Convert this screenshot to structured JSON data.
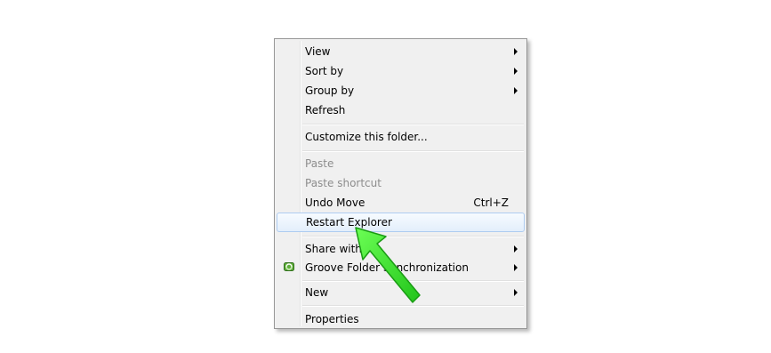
{
  "menu": {
    "items": [
      {
        "label": "View",
        "has_submenu": true
      },
      {
        "label": "Sort by",
        "has_submenu": true
      },
      {
        "label": "Group by",
        "has_submenu": true
      },
      {
        "label": "Refresh"
      },
      {
        "label": "Customize this folder..."
      },
      {
        "label": "Paste",
        "disabled": true
      },
      {
        "label": "Paste shortcut",
        "disabled": true
      },
      {
        "label": "Undo Move",
        "shortcut": "Ctrl+Z"
      },
      {
        "label": "Restart Explorer",
        "highlighted": true
      },
      {
        "label": "Share with",
        "has_submenu": true
      },
      {
        "label": "Groove Folder Synchronization",
        "has_submenu": true,
        "icon": "groove-icon"
      },
      {
        "label": "New",
        "has_submenu": true
      },
      {
        "label": "Properties"
      }
    ]
  },
  "colors": {
    "highlight_border": "#aeccf1",
    "annotation_arrow": "#35e82c",
    "disabled_text": "#8d8d8d"
  }
}
